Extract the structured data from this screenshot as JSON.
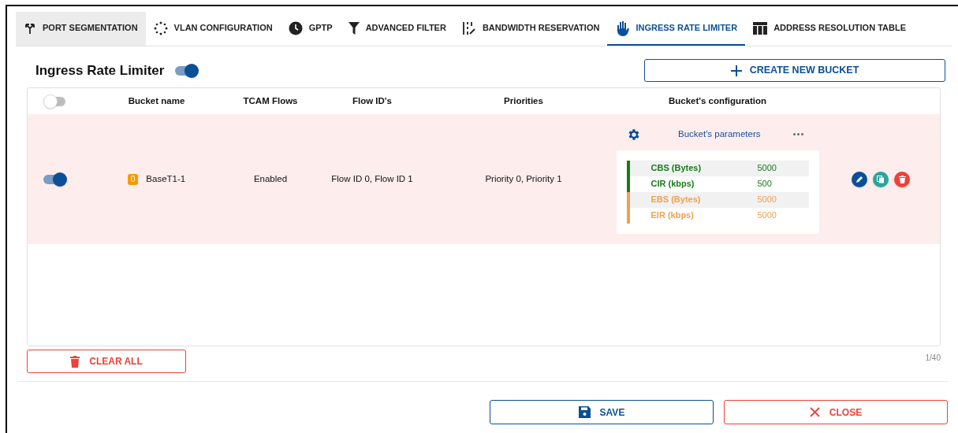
{
  "tabs": [
    {
      "label": "PORT SEGMENTATION",
      "selected": false,
      "hovered": true
    },
    {
      "label": "VLAN CONFIGURATION",
      "selected": false,
      "hovered": false
    },
    {
      "label": "GPTP",
      "selected": false,
      "hovered": false
    },
    {
      "label": "ADVANCED FILTER",
      "selected": false,
      "hovered": false
    },
    {
      "label": "BANDWIDTH RESERVATION",
      "selected": false,
      "hovered": false
    },
    {
      "label": "INGRESS RATE LIMITER",
      "selected": true,
      "hovered": false
    },
    {
      "label": "ADDRESS RESOLUTION TABLE",
      "selected": false,
      "hovered": false
    }
  ],
  "title": {
    "text": "Ingress Rate Limiter",
    "on": true
  },
  "create_button": "CREATE NEW BUCKET",
  "table": {
    "select_all_on": false,
    "columns": [
      "Bucket name",
      "TCAM Flows",
      "Flow ID's",
      "Priorities",
      "Bucket's configuration"
    ],
    "rows": [
      {
        "on": true,
        "badge": "0",
        "name": "BaseT1-1",
        "tcam": "Enabled",
        "flow_ids": "Flow ID 0, Flow ID 1",
        "priorities": "Priority 0, Priority 1",
        "config": {
          "title": "Bucket's parameters",
          "params": [
            {
              "label": "CBS (Bytes)",
              "value": "5000",
              "color": "#1a7a1a"
            },
            {
              "label": "CIR (kbps)",
              "value": "500",
              "color": "#1a7a1a"
            },
            {
              "label": "EBS (Bytes)",
              "value": "5000",
              "color": "#f0a050"
            },
            {
              "label": "EIR (kbps)",
              "value": "5000",
              "color": "#f0a050"
            }
          ]
        }
      }
    ]
  },
  "clear_button": "CLEAR ALL",
  "counter": "1/40",
  "save_button": "SAVE",
  "close_button": "CLOSE"
}
